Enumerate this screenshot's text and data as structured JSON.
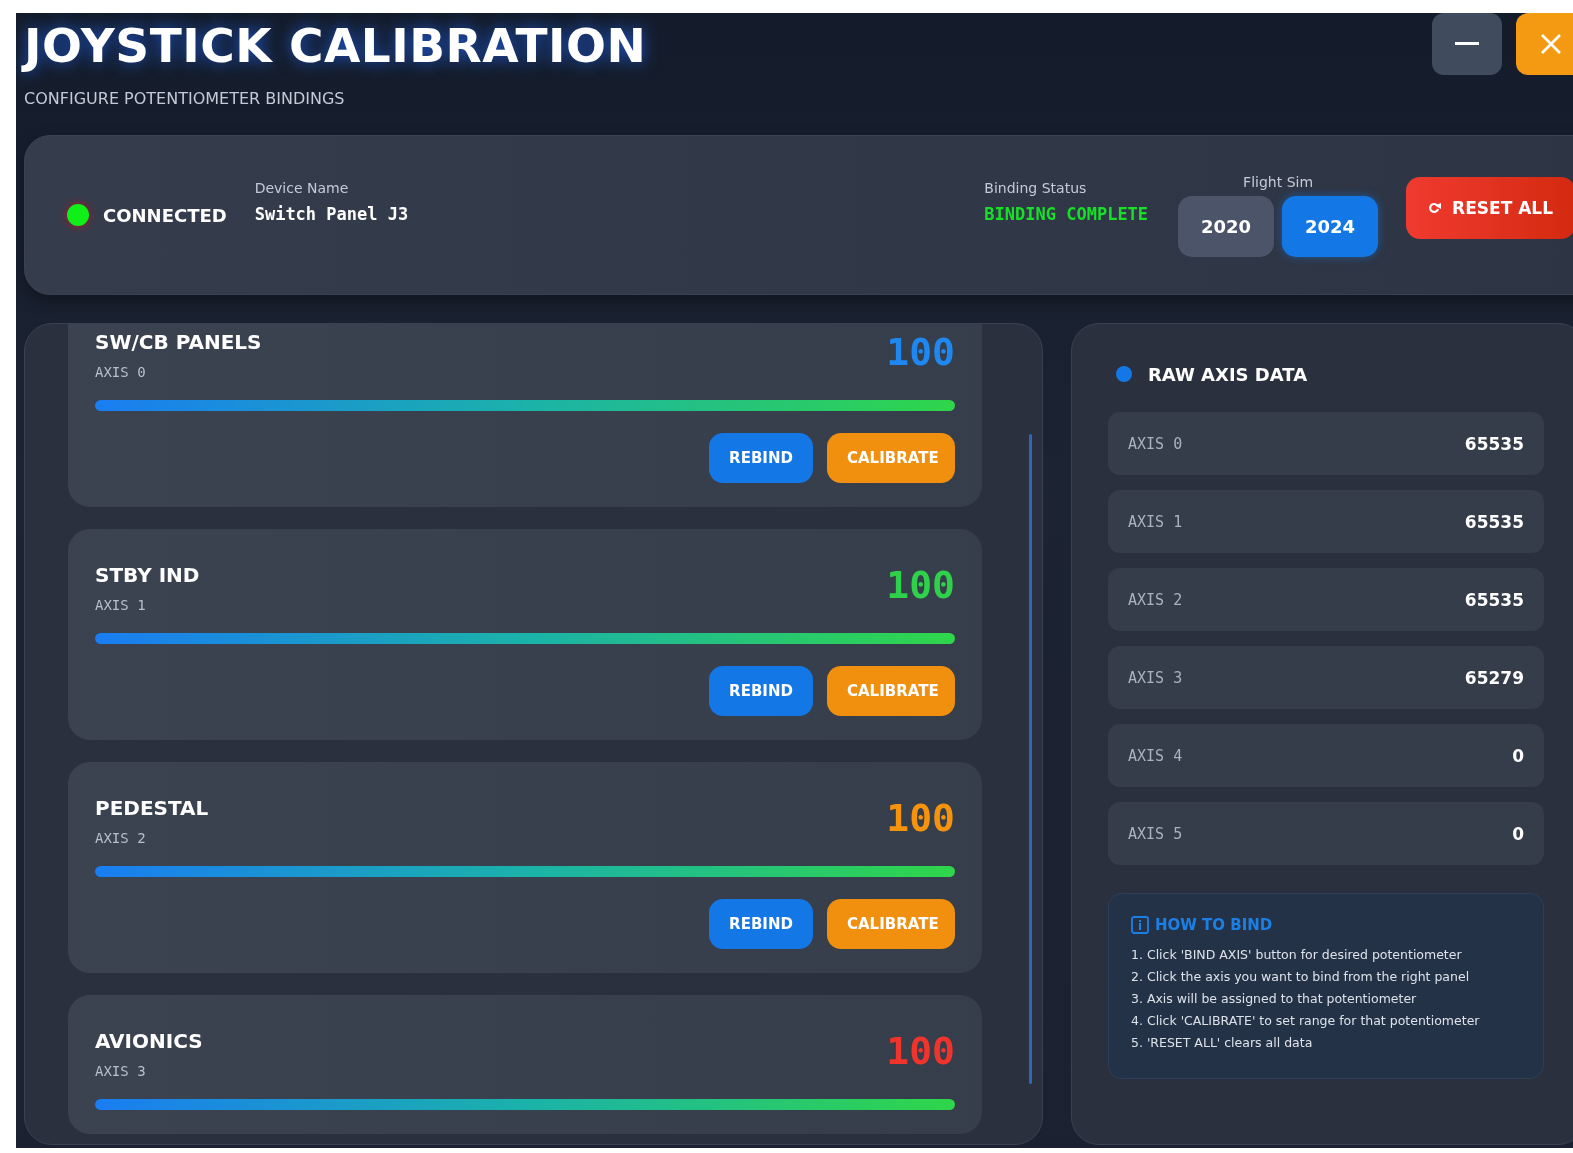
{
  "window": {
    "title": "JOYSTICK CALIBRATION",
    "subtitle": "CONFIGURE POTENTIOMETER BINDINGS",
    "controls": [
      {
        "kind": "minimize"
      },
      {
        "kind": "close"
      }
    ]
  },
  "status": {
    "connection": {
      "label": "CONNECTED",
      "connected": true
    },
    "device": {
      "label": "Device Name",
      "value": "Switch Panel J3"
    },
    "binding": {
      "label": "Binding Status",
      "value": "BINDING COMPLETE"
    },
    "flight_sim": {
      "label": "Flight Sim",
      "options": [
        {
          "label": "2020",
          "selected": false
        },
        {
          "label": "2024",
          "selected": true
        }
      ]
    },
    "reset_button": {
      "label": "RESET ALL"
    }
  },
  "potentiometers": [
    {
      "name": "SW/CB PANELS",
      "axis": "AXIS 0",
      "value": "100",
      "color": "#1e88f0",
      "level": 1,
      "buttons": [
        "REBIND",
        "CALIBRATE"
      ]
    },
    {
      "name": "STBY IND",
      "axis": "AXIS 1",
      "value": "100",
      "color": "#2fd14a",
      "level": 1,
      "buttons": [
        "REBIND",
        "CALIBRATE"
      ]
    },
    {
      "name": "PEDESTAL",
      "axis": "AXIS 2",
      "value": "100",
      "color": "#f5940c",
      "level": 1,
      "buttons": [
        "REBIND",
        "CALIBRATE"
      ]
    },
    {
      "name": "AVIONICS",
      "axis": "AXIS 3",
      "value": "100",
      "color": "#f0342c",
      "level": 1
    }
  ],
  "raw_axis": {
    "title": "RAW AXIS DATA",
    "rows": [
      {
        "label": "AXIS 0",
        "value": "65535"
      },
      {
        "label": "AXIS 1",
        "value": "65535"
      },
      {
        "label": "AXIS 2",
        "value": "65535"
      },
      {
        "label": "AXIS 3",
        "value": "65279"
      },
      {
        "label": "AXIS 4",
        "value": "0"
      },
      {
        "label": "AXIS 5",
        "value": "0"
      }
    ]
  },
  "how_to_bind": {
    "title": "HOW TO BIND",
    "steps": [
      "1. Click 'BIND AXIS' button for desired potentiometer",
      "2. Click the axis you want to bind from the right panel",
      "3. Axis will be assigned to that potentiometer",
      "4. Click 'CALIBRATE' to set range for that potentiometer",
      "5. 'RESET ALL' clears all data"
    ]
  }
}
